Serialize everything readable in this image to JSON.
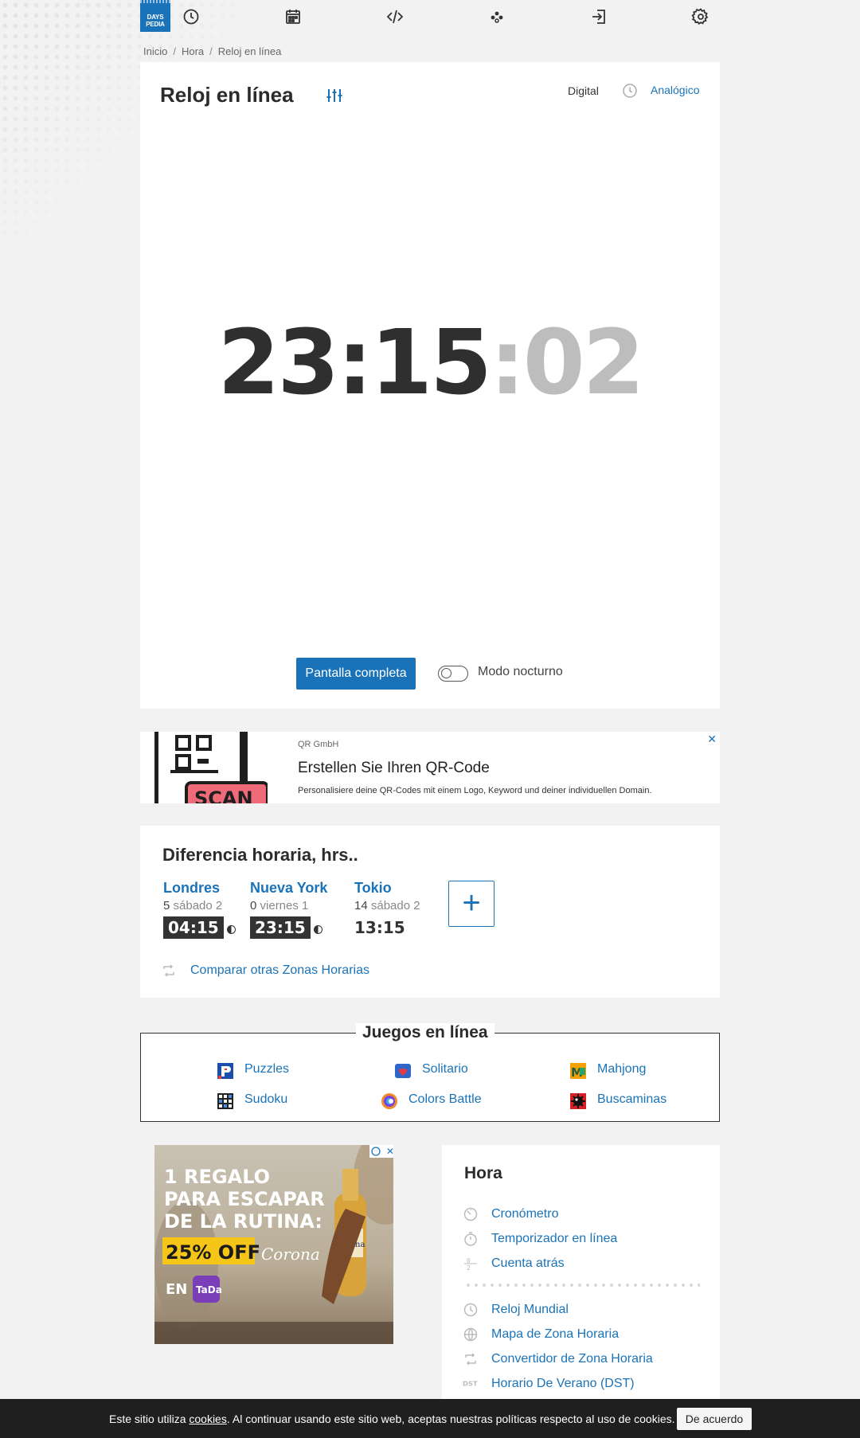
{
  "brand": {
    "logo_line1": "DAYS",
    "logo_line2": "PEDIA"
  },
  "nav": {
    "icons": [
      "clock-icon",
      "calendar-icon",
      "code-icon",
      "games-icon",
      "login-icon",
      "settings-icon"
    ]
  },
  "breadcrumb": {
    "items": [
      "Inicio",
      "Hora",
      "Reloj en línea"
    ]
  },
  "clock": {
    "title": "Reloj en línea",
    "mode_digital": "Digital",
    "mode_analog": "Analógico",
    "hours": "23",
    "minutes": "15",
    "seconds": "02",
    "colon": ":",
    "fullscreen_button": "Pantalla completa",
    "night_mode_label": "Modo nocturno",
    "night_mode_on": false
  },
  "ad1": {
    "brand": "QR GmbH",
    "headline": "Erstellen Sie Ihren QR-Code",
    "description": "Personalisiere deine QR-Codes mit einem Logo, Keyword und deiner individuellen Domain.",
    "image_text": "SCAN",
    "close": "✕"
  },
  "time_diff": {
    "title": "Diferencia horaria, hrs..",
    "cities": [
      {
        "name": "Londres",
        "offset": "5",
        "day": "sábado 2",
        "time": "04:15",
        "night": true
      },
      {
        "name": "Nueva York",
        "offset": "0",
        "day": "viernes 1",
        "time": "23:15",
        "night": true
      },
      {
        "name": "Tokio",
        "offset": "14",
        "day": "sábado 2",
        "time": "13:15",
        "night": false
      }
    ],
    "add_button": "+",
    "compare_link": "Comparar otras Zonas Horarias"
  },
  "games": {
    "title": "Juegos en línea",
    "items": [
      {
        "label": "Puzzles",
        "icon": "puzzles-icon"
      },
      {
        "label": "Solitario",
        "icon": "solitaire-icon"
      },
      {
        "label": "Mahjong",
        "icon": "mahjong-icon"
      },
      {
        "label": "Sudoku",
        "icon": "sudoku-icon"
      },
      {
        "label": "Colors Battle",
        "icon": "colors-battle-icon"
      },
      {
        "label": "Buscaminas",
        "icon": "minesweeper-icon"
      }
    ]
  },
  "ad2": {
    "line1": "1 REGALO",
    "line2": "PARA ESCAPAR",
    "line3": "DE LA RUTINA:",
    "offer": "25% OFF",
    "en": "EN",
    "app": "TaDa",
    "brand": "Corona"
  },
  "hora": {
    "title": "Hora",
    "group1": [
      {
        "label": "Cronómetro",
        "icon": "stopwatch-icon"
      },
      {
        "label": "Temporizador en línea",
        "icon": "timer-icon"
      },
      {
        "label": "Cuenta atrás",
        "icon": "countdown-icon"
      }
    ],
    "group2": [
      {
        "label": "Reloj Mundial",
        "icon": "world-clock-icon"
      },
      {
        "label": "Mapa de Zona Horaria",
        "icon": "globe-icon"
      },
      {
        "label": "Convertidor de Zona Horaria",
        "icon": "convert-icon"
      },
      {
        "label": "Horario De Verano (DST)",
        "icon": "dst-icon"
      }
    ],
    "dst_icon_text": "DST"
  },
  "cookie": {
    "text_before": "Este sitio utiliza ",
    "link": "cookies",
    "text_after": ". Al continuar usando este sitio web, aceptas nuestras políticas respecto al uso de cookies.",
    "button": "De acuerdo"
  },
  "colors": {
    "accent": "#1a73b8",
    "dark": "#333333",
    "seconds": "#bdbdbd"
  }
}
